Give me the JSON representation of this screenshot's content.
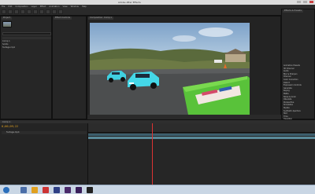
{
  "window": {
    "title": "Adobe After Effects"
  },
  "menu": [
    "File",
    "Edit",
    "Composition",
    "Layer",
    "Effect",
    "Animation",
    "View",
    "Window",
    "Help"
  ],
  "project_panel": {
    "tab": "Project",
    "rows": [
      "Comp 1",
      "Solids",
      "footage.mp4"
    ]
  },
  "effects_panel": {
    "tab": "Effect Controls"
  },
  "composition_panel": {
    "tab": "Composition: Comp 1"
  },
  "right_panel": {
    "tab": "Effects & Presets",
    "items": [
      "Animation Presets",
      "3D Channel",
      "Audio",
      "Blur & Sharpen",
      "Channel",
      "Color Correction",
      "Distort",
      "Expression Controls",
      "Generate",
      "Keying",
      "Matte",
      "Noise & Grain",
      "Obsolete",
      "Perspective",
      "Simulation",
      "Stylize",
      "Synthetic Aperture",
      "Text",
      "Time",
      "Transition",
      "Utility"
    ]
  },
  "timeline": {
    "timecode": "0;00;09;22",
    "tab": "Comp 1",
    "layer_names": [
      "footage.mp4"
    ]
  },
  "colors": {
    "accent": "#e0a020",
    "playhead": "#dd3333",
    "track": "#5a8a9a"
  }
}
